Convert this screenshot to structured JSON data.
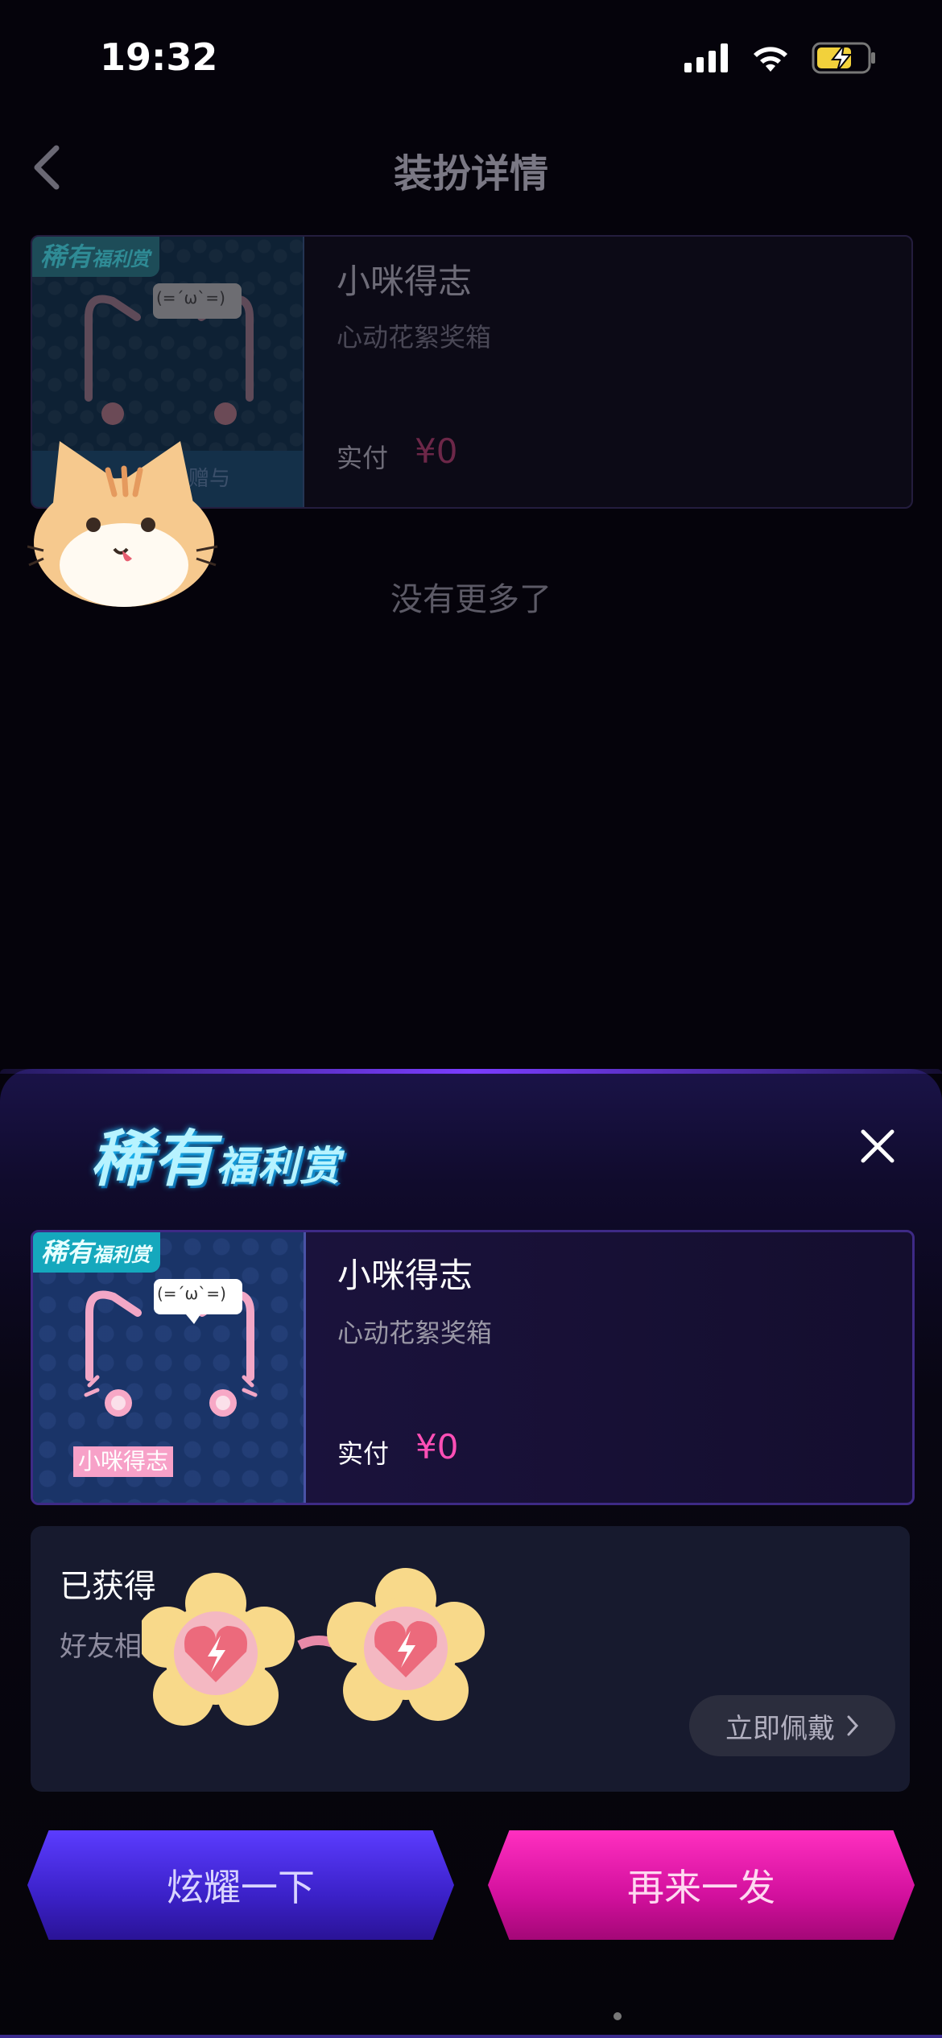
{
  "status_bar": {
    "time": "19:32"
  },
  "header": {
    "title": "装扮详情"
  },
  "background_card": {
    "tag_big": "稀有",
    "tag_small": "福利赏",
    "bubble_face": "(=´ω`=)",
    "bottom_text": "___想___赠与",
    "name": "小咪得志",
    "subtitle": "心动花絮奖箱",
    "pay_label": "实付",
    "price": "¥0"
  },
  "list_end_text": "没有更多了",
  "sheet": {
    "logo_big": "稀有",
    "logo_small": "福利赏",
    "item": {
      "tag_big": "稀有",
      "tag_small": "福利赏",
      "bubble_face": "(=´ω`=)",
      "thumb_label": "小咪得志",
      "name": "小咪得志",
      "subtitle": "心动花絮奖箱",
      "pay_label": "实付",
      "price": "¥0"
    },
    "obtained": {
      "title": "已获得",
      "description": "好友相",
      "wear_button": "立即佩戴"
    },
    "show_button": "炫耀一下",
    "again_button": "再来一发"
  },
  "colors": {
    "accent_pink": "#ff4fb6",
    "button_purple": "#4a2ee8",
    "button_pink": "#e81aae"
  }
}
